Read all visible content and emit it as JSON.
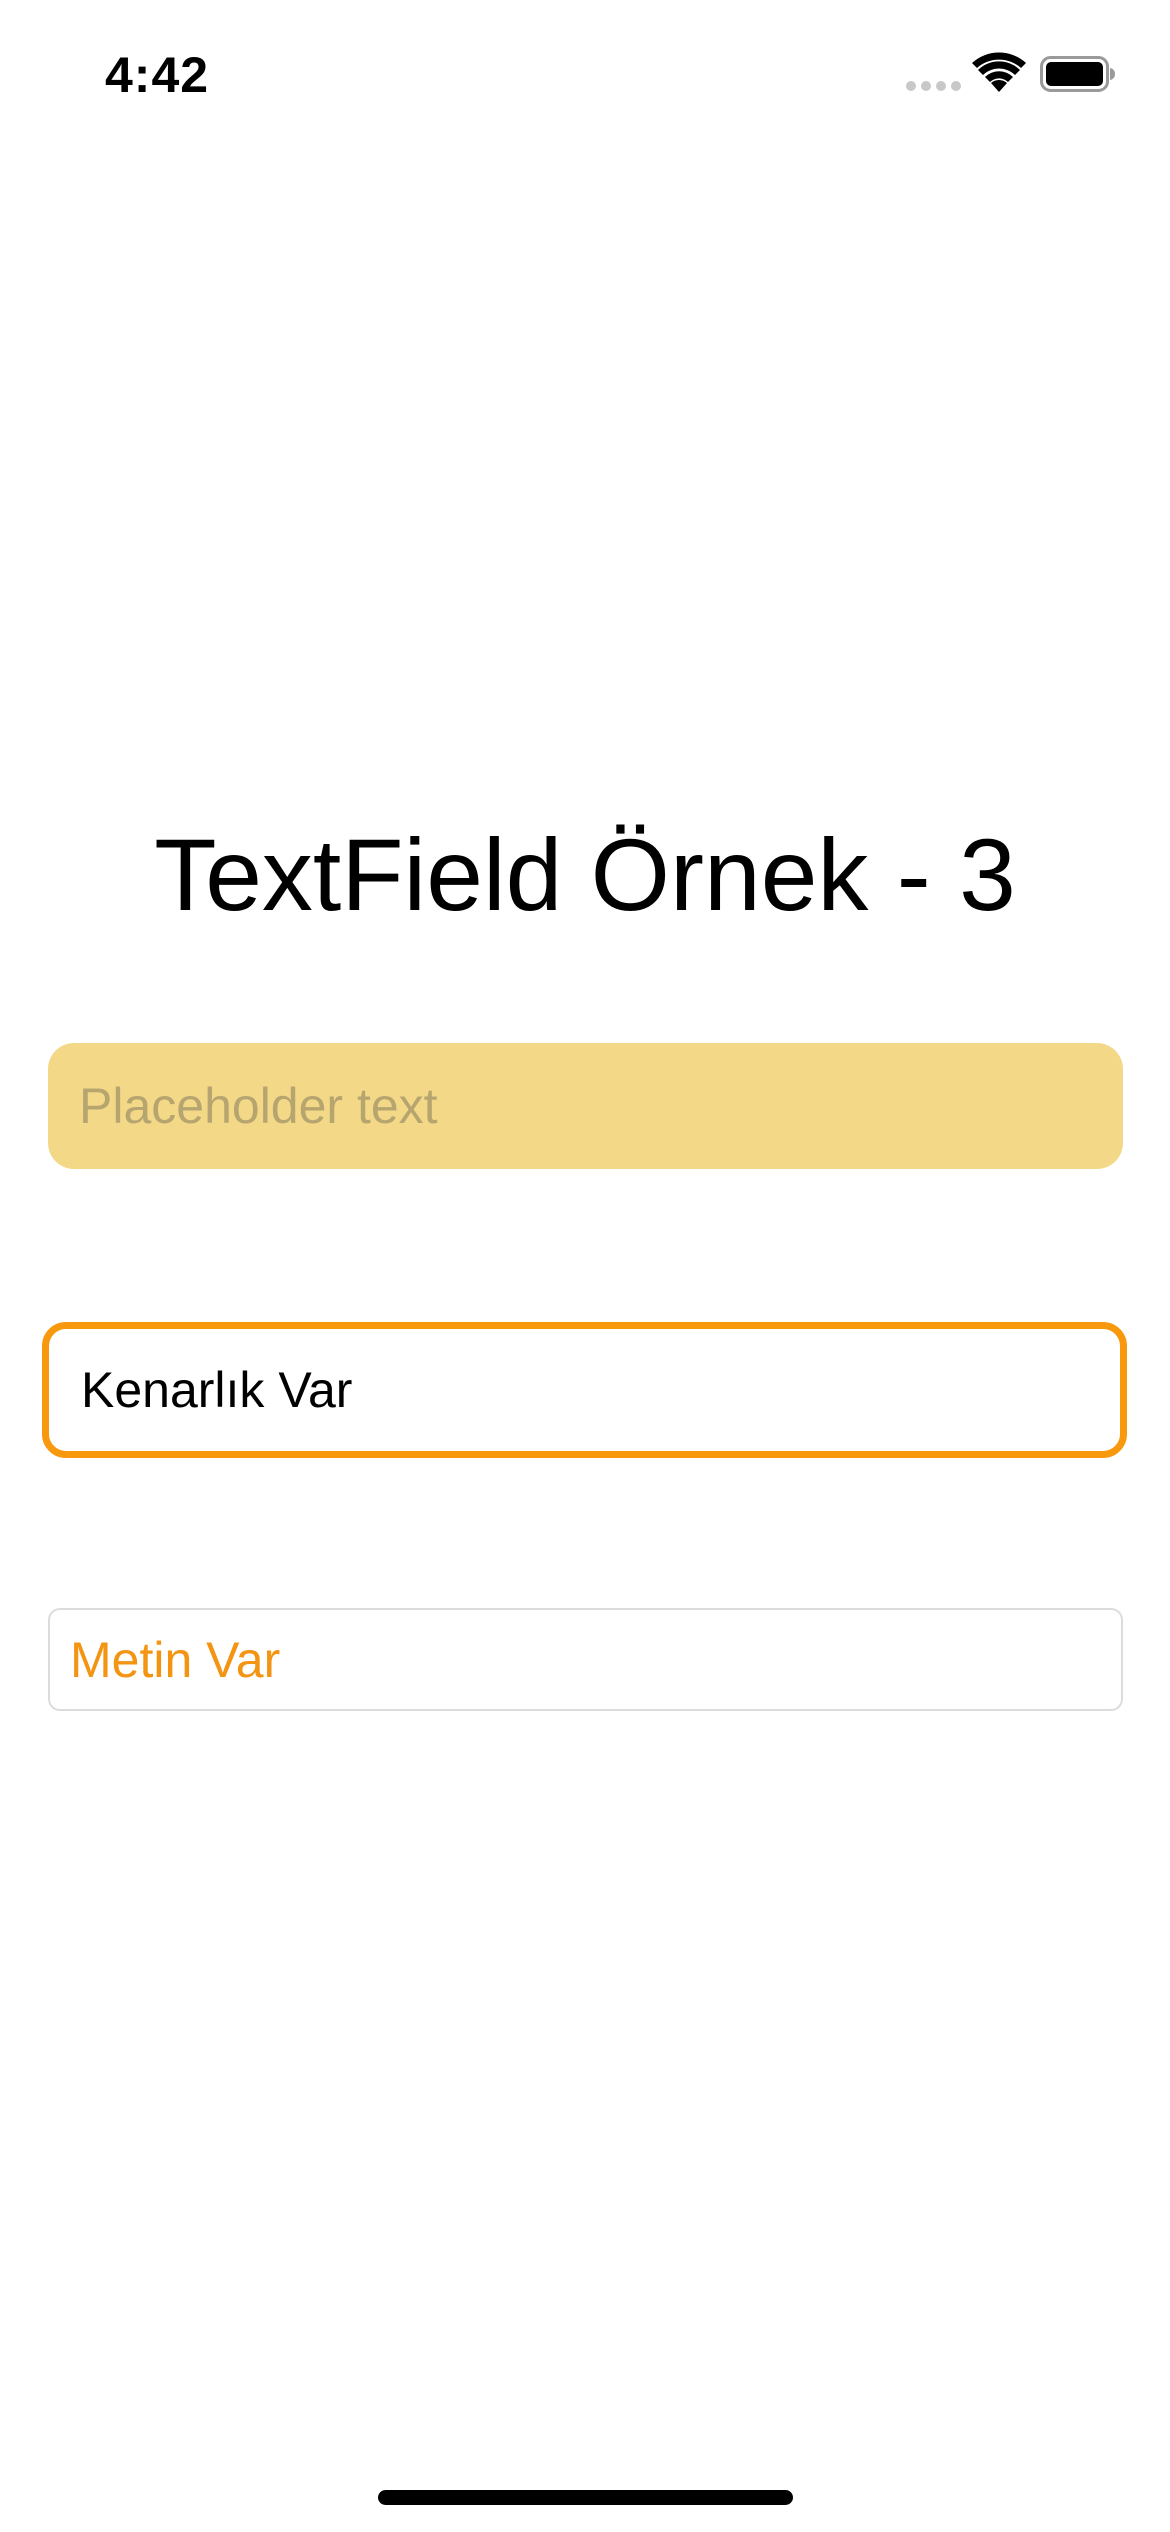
{
  "status_bar": {
    "time": "4:42",
    "icons": {
      "signal": "cellular-signal-icon",
      "wifi": "wifi-icon",
      "battery": "battery-icon"
    }
  },
  "title": "TextField Örnek - 3",
  "fields": {
    "filled": {
      "value": "",
      "placeholder": "Placeholder text",
      "background_color": "#f3d987"
    },
    "bordered": {
      "value": "Kenarlık Var",
      "border_color": "#f8980d"
    },
    "plain": {
      "value": "Metin Var",
      "text_color": "#f39413"
    }
  }
}
